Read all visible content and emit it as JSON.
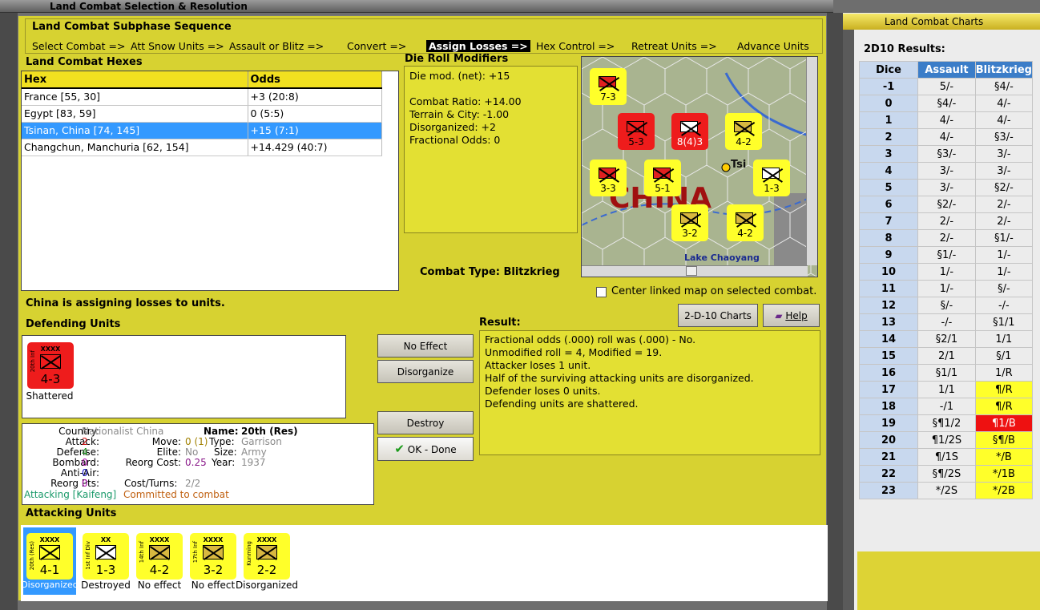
{
  "window": {
    "title": "Land Combat Selection & Resolution"
  },
  "sequence": {
    "header": "Land Combat Subphase Sequence",
    "steps": [
      "Select Combat =>",
      "Att Snow Units =>",
      "Assault or Blitz =>",
      "Convert =>",
      "Assign Losses =>",
      "Hex Control =>",
      "Retreat Units =>",
      "Advance Units"
    ],
    "active_index": 4
  },
  "hexes": {
    "header": "Land Combat Hexes",
    "columns": [
      "Hex",
      "Odds"
    ],
    "rows": [
      {
        "hex": "France [55, 30]",
        "odds": "+3 (20:8)"
      },
      {
        "hex": "Egypt [83, 59]",
        "odds": "0 (5:5)"
      },
      {
        "hex": "Tsinan, China [74, 145]",
        "odds": "+15 (7:1)"
      },
      {
        "hex": "Changchun, Manchuria [62, 154]",
        "odds": "+14.429 (40:7)"
      }
    ],
    "selected_index": 2
  },
  "modifiers": {
    "header": "Die Roll Modifiers",
    "lines": [
      "Die mod. (net): +15",
      "",
      "Combat Ratio: +14.00",
      "Terrain & City: -1.00",
      "Disorganized: +2",
      "Fractional Odds: 0"
    ]
  },
  "combat_type": "Combat Type:  Blitzkrieg",
  "center_map_label": "Center linked map on selected combat.",
  "assigning_text": "China is assigning losses to units.",
  "defending": {
    "header": "Defending Units",
    "units": [
      {
        "type": "XXXX",
        "side": "20th Inf",
        "value": "4-3",
        "status": "Shattered"
      }
    ]
  },
  "buttons": {
    "no_effect": "No Effect",
    "disorganize": "Disorganize",
    "destroy": "Destroy",
    "ok_done": "OK - Done",
    "charts": "2-D-10 Charts",
    "help": "Help"
  },
  "result": {
    "header": "Result:",
    "lines": [
      "Fractional odds (.000) roll was (.000)  - No.",
      "Unmodified roll = 4, Modified = 19.",
      "Attacker loses 1 unit.",
      "Half of the surviving attacking units are disorganized.",
      "Defender loses 0 units.",
      "Defending units are shattered."
    ]
  },
  "unit_info": {
    "country_label": "Country:",
    "country": "Nationalist China",
    "name_label": "Name:",
    "name": "20th (Res)",
    "attack_label": "Attack:",
    "attack": "2",
    "move_label": "Move:",
    "move": "0 (1)",
    "type_label": "Type:",
    "type": "Garrison",
    "defense_label": "Defense:",
    "defense": "4",
    "elite_label": "Elite:",
    "elite": "No",
    "size_label": "Size:",
    "size": "Army",
    "bombard_label": "Bombard:",
    "bombard": "0",
    "reorg_cost_label": "Reorg Cost:",
    "reorg_cost": "0.25",
    "year_label": "Year:",
    "year": "1937",
    "antiair_label": "Anti-Air:",
    "antiair": "0",
    "reorg_pts_label": "Reorg Pts:",
    "reorg_pts": "0",
    "cost_turns_label": "Cost/Turns:",
    "cost_turns": "2/2",
    "attacking_text": "Attacking [Kaifeng]",
    "committed_text": "Committed to combat"
  },
  "attacking": {
    "header": "Attacking Units",
    "units": [
      {
        "type": "XXXX",
        "side": "20th (Res)",
        "value": "4-1",
        "status": "Disorganized"
      },
      {
        "type": "XX",
        "side": "1st Inf Div",
        "value": "1-3",
        "status": "Destroyed"
      },
      {
        "type": "XXXX",
        "side": "14th Inf",
        "value": "4-2",
        "status": "No effect"
      },
      {
        "type": "XXXX",
        "side": "17th Inf",
        "value": "3-2",
        "status": "No effect"
      },
      {
        "type": "XXXX",
        "side": "Kunming",
        "value": "2-2",
        "status": "Disorganized"
      }
    ]
  },
  "map": {
    "label_lake": "Lake Chaoyang",
    "label_country": "CHINA",
    "label_city": "Tsi",
    "counters": [
      "7-3",
      "5-3",
      "8(4)3",
      "4-2",
      "3-3",
      "5-1",
      "1-3",
      "3-2",
      "4-2"
    ]
  },
  "charts": {
    "window_title": "Land Combat Charts",
    "header": "2D10 Results:",
    "columns": [
      "Dice",
      "Assault",
      "Blitzkrieg"
    ],
    "rows": [
      [
        "-1",
        "5/-",
        "§4/-"
      ],
      [
        "0",
        "§4/-",
        "4/-"
      ],
      [
        "1",
        "4/-",
        "4/-"
      ],
      [
        "2",
        "4/-",
        "§3/-"
      ],
      [
        "3",
        "§3/-",
        "3/-"
      ],
      [
        "4",
        "3/-",
        "3/-"
      ],
      [
        "5",
        "3/-",
        "§2/-"
      ],
      [
        "6",
        "§2/-",
        "2/-"
      ],
      [
        "7",
        "2/-",
        "2/-"
      ],
      [
        "8",
        "2/-",
        "§1/-"
      ],
      [
        "9",
        "§1/-",
        "1/-"
      ],
      [
        "10",
        "1/-",
        "1/-"
      ],
      [
        "11",
        "1/-",
        "§/-"
      ],
      [
        "12",
        "§/-",
        "-/-"
      ],
      [
        "13",
        "-/-",
        "§1/1"
      ],
      [
        "14",
        "§2/1",
        "1/1"
      ],
      [
        "15",
        "2/1",
        "§/1"
      ],
      [
        "16",
        "§1/1",
        "1/R"
      ],
      [
        "17",
        "1/1",
        "¶/R"
      ],
      [
        "18",
        "-/1",
        "¶/R"
      ],
      [
        "19",
        "§¶1/2",
        "¶1/B"
      ],
      [
        "20",
        "¶1/2S",
        "§¶/B"
      ],
      [
        "21",
        "¶/1S",
        "*/B"
      ],
      [
        "22",
        "§¶/2S",
        "*/1B"
      ],
      [
        "23",
        "*/2S",
        "*/2B"
      ]
    ],
    "highlight_colors": {
      "yellow": "#ffff2a",
      "red": "#ee1111"
    }
  }
}
